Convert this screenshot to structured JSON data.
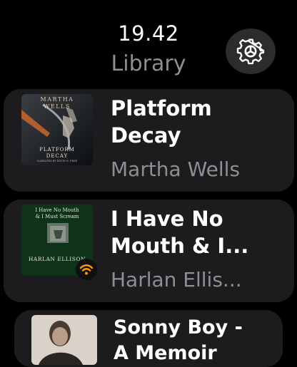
{
  "status": {
    "time": "19.42"
  },
  "header": {
    "title": "Library"
  },
  "books": [
    {
      "title": "Platform Decay",
      "title_line1": "Platform",
      "title_line2": "Decay",
      "author": "Martha Wells",
      "cover": {
        "line1": "MARTHA",
        "line2": "WELLS",
        "line3": "PLATFORM",
        "line4": "DECAY",
        "narrator": "NARRATED BY KEVIN R. FREE"
      }
    },
    {
      "title": "I Have No Mouth & I...",
      "title_line1": "I Have No",
      "title_line2": "Mouth & I...",
      "author": "Harlan Ellis...",
      "cover": {
        "line1": "I Have No Mouth",
        "line2": "& I Must Scream",
        "line3": "HARLAN ELLISON"
      },
      "badge_icon": "wifi-icon"
    },
    {
      "title": "Sonny Boy - A Memoir",
      "title_line1": "Sonny Boy -",
      "title_line2": "A Memoir"
    }
  ],
  "colors": {
    "background": "#000000",
    "card": "#1c1c1e",
    "secondary_text": "#8e8e93",
    "badge_accent": "#ff9500"
  },
  "icons": {
    "settings": "gear-icon"
  }
}
